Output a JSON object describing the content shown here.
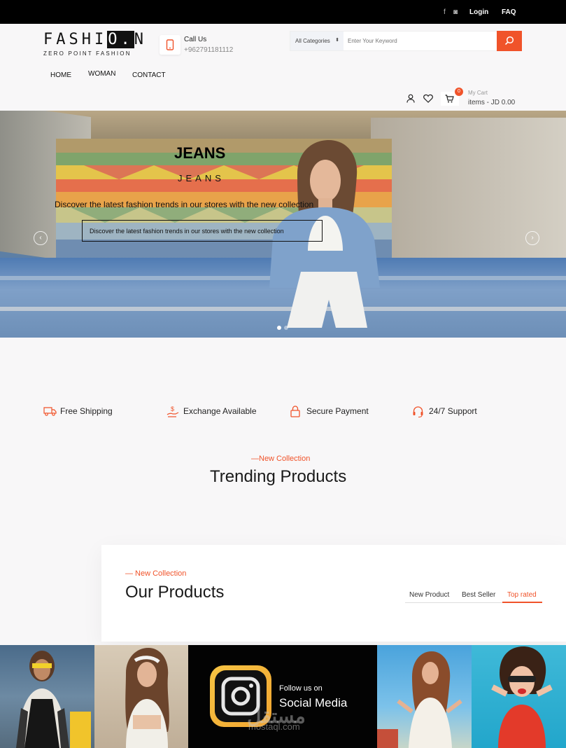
{
  "topbar": {
    "login": "Login",
    "faq": "FAQ",
    "social_icons": [
      "facebook-icon",
      "instagram-icon"
    ]
  },
  "logo": {
    "brand_pre": "FASHI",
    "brand_box": "O.",
    "brand_post": "N",
    "tagline": "ZERO POINT FASHION"
  },
  "contact": {
    "title": "Call Us",
    "phone": "+962791181112"
  },
  "search": {
    "category": "All Categories",
    "placeholder": "Enter Your Keyword"
  },
  "nav": {
    "items": [
      "HOME",
      "WOMAN",
      "CONTACT"
    ]
  },
  "cart": {
    "count": "0",
    "label": "My Cart",
    "summary": "items - JD 0.00"
  },
  "hero": {
    "title": "JEANS",
    "subtitle": "JEANS",
    "description": "Discover the latest fashion trends in our stores with the new collection",
    "button": "Discover the latest fashion trends in our stores with the new collection",
    "prev": "‹",
    "next": "›"
  },
  "features": [
    "Free Shipping",
    "Exchange Available",
    "Secure Payment",
    "24/7 Support"
  ],
  "trending": {
    "kicker": "—New Collection",
    "title": "Trending Products"
  },
  "products": {
    "kicker": "— New Collection",
    "title": "Our Products",
    "tabs": [
      "New Product",
      "Best Seller",
      "Top rated"
    ],
    "active_tab": "Top rated"
  },
  "social": {
    "line1": "Follow us on",
    "line2": "Social Media",
    "watermark": "مستقل",
    "watermark_url": "mostaql.com"
  },
  "colors": {
    "accent": "#f0532a",
    "topbar": "#000000"
  }
}
